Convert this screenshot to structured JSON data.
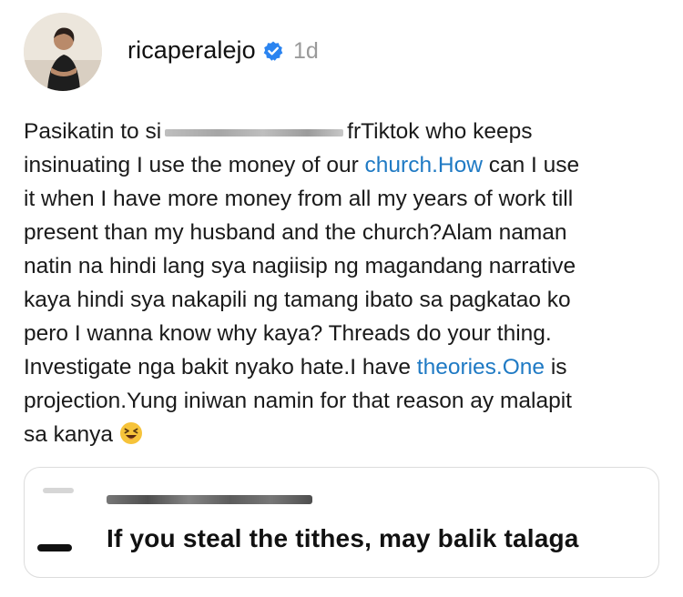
{
  "post": {
    "author": {
      "username": "ricaperalejo",
      "verified_icon": "verified-badge-icon",
      "time_ago": "1d",
      "avatar": "profile-photo"
    },
    "text": {
      "l1_a": "Pasikatin to si",
      "l1_b": "frTiktok who keeps",
      "l2_a": "insinuating I use the money of our ",
      "l2_link": "church.How",
      "l2_b": " can I use",
      "l3": "it when I have more money from all my years of work till",
      "l4": "present than my husband and the church?Alam naman",
      "l5": "natin na hindi lang sya nagiisip ng magandang narrative",
      "l6": "kaya hindi sya nakapili ng tamang ibato sa pagkatao ko",
      "l7": "pero I wanna know why kaya? Threads do your thing.",
      "l8_a": "Investigate nga bakit nyako hate.I have ",
      "l8_link": "theories.One",
      "l8_b": " is",
      "l9": "projection.Yung iniwan namin for that reason ay malapit",
      "l10": "sa kanya",
      "emoji": "laughing-face-emoji"
    },
    "colors": {
      "link": "#1f7ac4",
      "verified": "#2b84f0",
      "muted": "#9a9a9a"
    }
  },
  "quoted_post": {
    "text": "If you steal the tithes, may balik talaga"
  }
}
